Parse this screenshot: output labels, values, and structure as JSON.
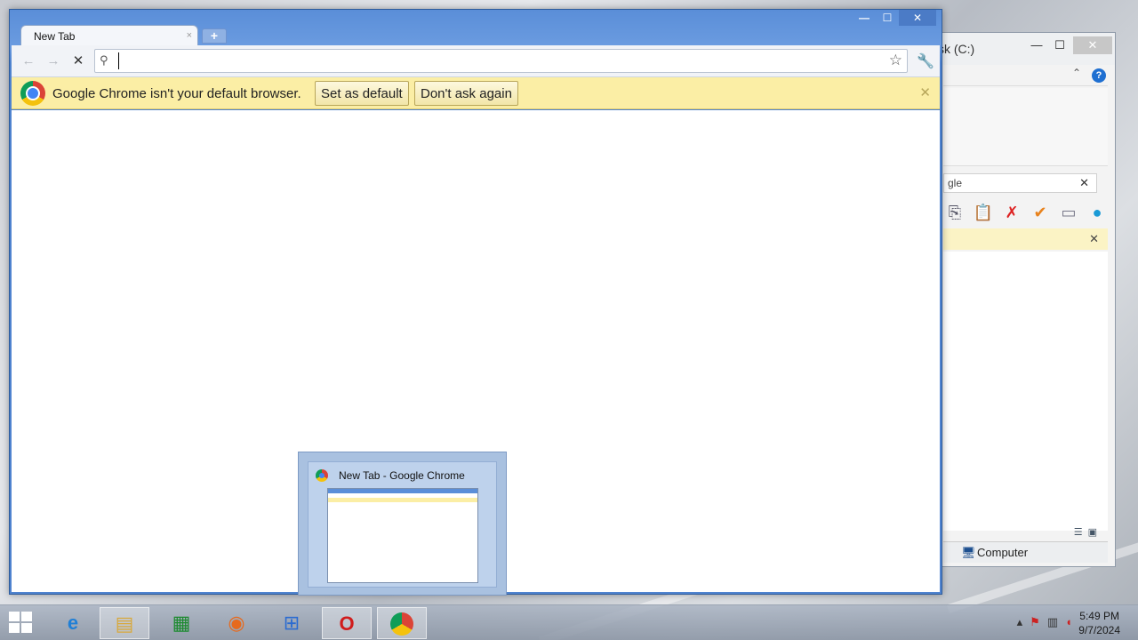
{
  "explorer": {
    "title": "sk (C:)",
    "minimize": "—",
    "maximize": "☐",
    "close": "✕",
    "up_icon": "chevron-up-icon",
    "help": "?",
    "search_value": "gle",
    "search_clear": "✕",
    "infobar_close": "✕",
    "status_location": "Computer"
  },
  "chrome": {
    "caption": {
      "minimize": "—",
      "maximize": "☐",
      "close": "✕"
    },
    "tab": {
      "title": "New Tab",
      "close": "×"
    },
    "new_tab": "+",
    "omnibox": {
      "value": "",
      "placeholder": ""
    },
    "infobar": {
      "message": "Google Chrome isn't your default browser.",
      "set_default": "Set as default",
      "dont_ask": "Don't ask again",
      "close": "✕"
    }
  },
  "thumbnail": {
    "title": "New Tab - Google Chrome"
  },
  "taskbar": {
    "apps": [
      "internet-explorer",
      "file-explorer",
      "store",
      "firefox",
      "windows-live",
      "opera",
      "chrome"
    ],
    "time": "5:49 PM",
    "date": "9/7/2024"
  }
}
